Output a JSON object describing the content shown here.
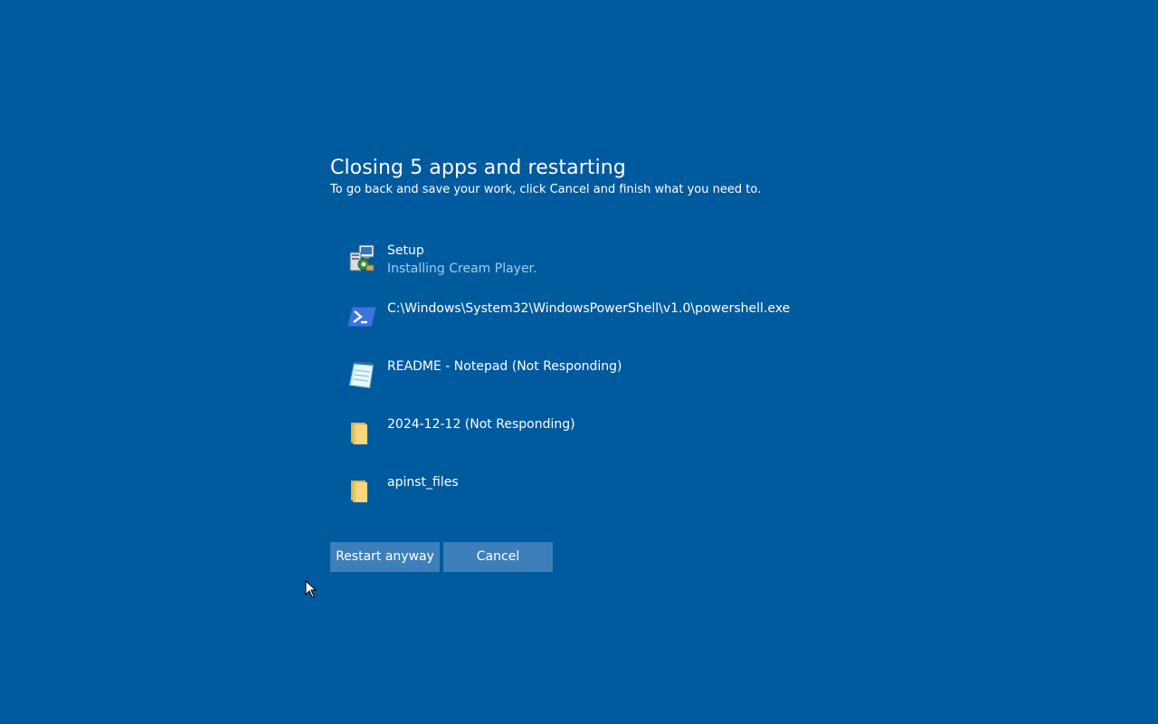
{
  "dialog": {
    "title": "Closing 5 apps and restarting",
    "subtitle": "To go back and save your work, click Cancel and finish what you need to."
  },
  "apps": [
    {
      "name": "Setup",
      "status": "Installing Cream Player.",
      "icon": "setup-installer-icon"
    },
    {
      "name": "C:\\Windows\\System32\\WindowsPowerShell\\v1.0\\powershell.exe",
      "status": "",
      "icon": "powershell-icon"
    },
    {
      "name": "README - Notepad (Not Responding)",
      "status": "",
      "icon": "notepad-icon"
    },
    {
      "name": "2024-12-12 (Not Responding)",
      "status": "",
      "icon": "folder-icon"
    },
    {
      "name": "apinst_files",
      "status": "",
      "icon": "folder-icon"
    }
  ],
  "buttons": {
    "restart_label": "Restart anyway",
    "cancel_label": "Cancel"
  },
  "colors": {
    "background": "#005a9e",
    "button": "#3d80b9",
    "status_text": "#9ccff5"
  }
}
